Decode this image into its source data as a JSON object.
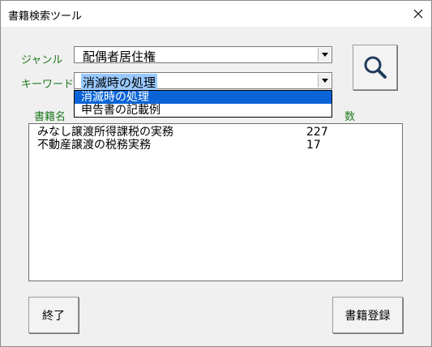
{
  "window": {
    "title": "書籍検索ツール"
  },
  "form": {
    "genre_label": "ジャンル",
    "genre_value": "配偶者居住権",
    "keyword_label": "キーワード",
    "keyword_value": "消滅時の処理",
    "keyword_options": [
      "消滅時の処理",
      "申告書の記載例"
    ]
  },
  "results": {
    "header_title": "書籍名",
    "header_count_partial": "数",
    "rows": [
      {
        "title": "みなし譲渡所得課税の実務",
        "count": "227"
      },
      {
        "title": "不動産譲渡の税務実務",
        "count": "17"
      }
    ]
  },
  "buttons": {
    "exit": "終了",
    "register": "書籍登録"
  },
  "icons": {
    "search": "search-icon",
    "close": "close-icon",
    "dropdown": "chevron-down-icon"
  },
  "colors": {
    "label_green": "#1f7a1f",
    "selection_blue": "#0a64d8",
    "highlight_blue": "#99c9ff"
  }
}
